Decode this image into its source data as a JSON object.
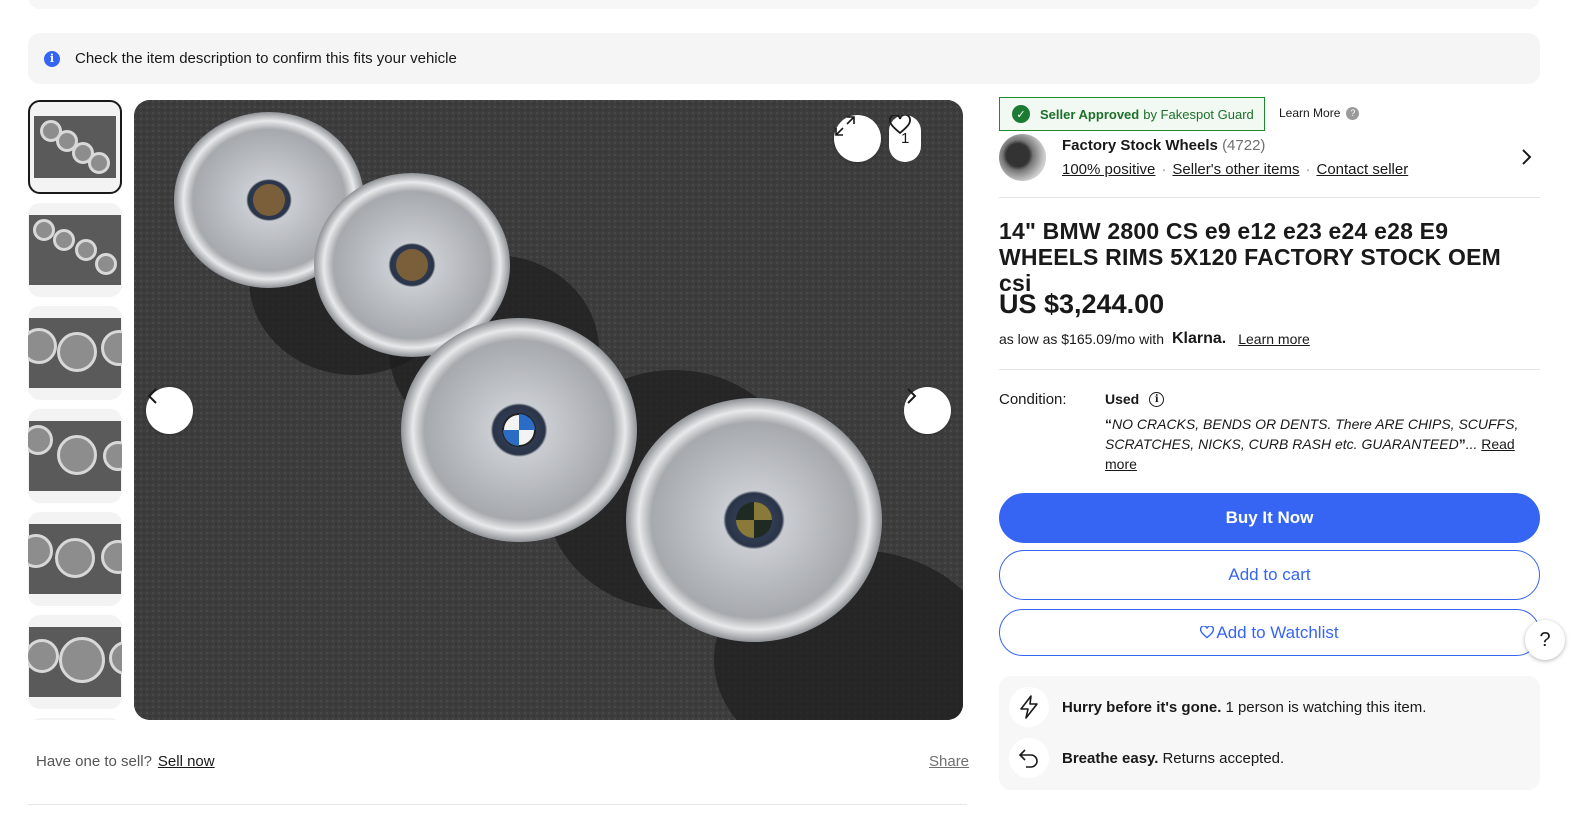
{
  "notice": {
    "text": "Check the item description to confirm this fits your vehicle",
    "icon": "info-icon"
  },
  "gallery": {
    "thumbnail_count": 7,
    "selected_index": 0,
    "watch_count": "1",
    "share_label": "Share"
  },
  "sell_prompt": {
    "text": "Have one to sell?",
    "link": "Sell now"
  },
  "fakespot": {
    "strong": "Seller Approved",
    "rest": "by Fakespot Guard",
    "learn_more": "Learn More"
  },
  "seller": {
    "name": "Factory Stock Wheels",
    "feedback_count": "(4722)",
    "positive": "100% positive",
    "other_items": "Seller's other items",
    "contact": "Contact seller"
  },
  "listing": {
    "title": "14\" BMW 2800 CS e9 e12 e23 e24 e28 E9 WHEELS RIMS 5X120 FACTORY STOCK OEM csi",
    "price": "US $3,244.00",
    "klarna_prefix": "as low as $165.09/mo with",
    "klarna_brand": "Klarna.",
    "klarna_link": "Learn more"
  },
  "condition": {
    "label": "Condition:",
    "value": "Used",
    "description": "NO CRACKS, BENDS OR DENTS. There ARE CHIPS, SCUFFS, SCRATCHES, NICKS, CURB RASH etc. GUARANTEED",
    "read_more": "Read more"
  },
  "actions": {
    "buy_now": "Buy It Now",
    "add_to_cart": "Add to cart",
    "add_to_watchlist": "Add to Watchlist"
  },
  "urgency": {
    "row1_bold": "Hurry before it's gone.",
    "row1_text": "1 person is watching this item.",
    "row2_bold": "Breathe easy.",
    "row2_text": "Returns accepted."
  },
  "help_label": "?",
  "colors": {
    "accent": "#3665f3",
    "fakespot_green": "#1d7a33"
  }
}
